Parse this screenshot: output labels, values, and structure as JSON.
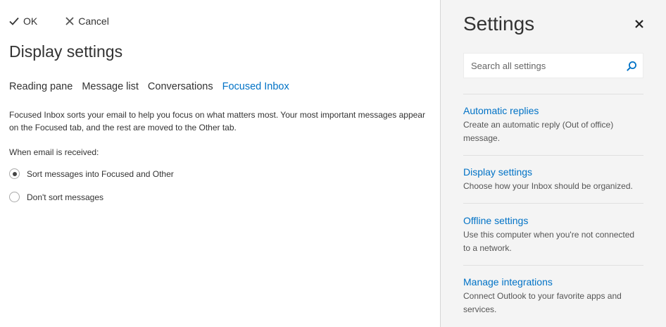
{
  "toolbar": {
    "ok_label": "OK",
    "cancel_label": "Cancel"
  },
  "main": {
    "title": "Display settings",
    "tabs": [
      {
        "label": "Reading pane",
        "active": false
      },
      {
        "label": "Message list",
        "active": false
      },
      {
        "label": "Conversations",
        "active": false
      },
      {
        "label": "Focused Inbox",
        "active": true
      }
    ],
    "description": "Focused Inbox sorts your email to help you focus on what matters most. Your most important messages appear on the Focused tab, and the rest are moved to the Other tab.",
    "when_label": "When email is received:",
    "options": [
      {
        "label": "Sort messages into Focused and Other",
        "selected": true
      },
      {
        "label": "Don't sort messages",
        "selected": false
      }
    ]
  },
  "settings": {
    "title": "Settings",
    "search_placeholder": "Search all settings",
    "items": [
      {
        "title": "Automatic replies",
        "description": "Create an automatic reply (Out of office) message."
      },
      {
        "title": "Display settings",
        "description": "Choose how your Inbox should be organized."
      },
      {
        "title": "Offline settings",
        "description": "Use this computer when you're not connected to a network."
      },
      {
        "title": "Manage integrations",
        "description": "Connect Outlook to your favorite apps and services."
      }
    ]
  },
  "colors": {
    "accent": "#0072c6",
    "panel_bg": "#f4f4f4",
    "text": "#333333"
  },
  "icons": {
    "ok": "checkmark-icon",
    "cancel": "x-icon",
    "close": "close-icon",
    "search": "search-icon"
  }
}
